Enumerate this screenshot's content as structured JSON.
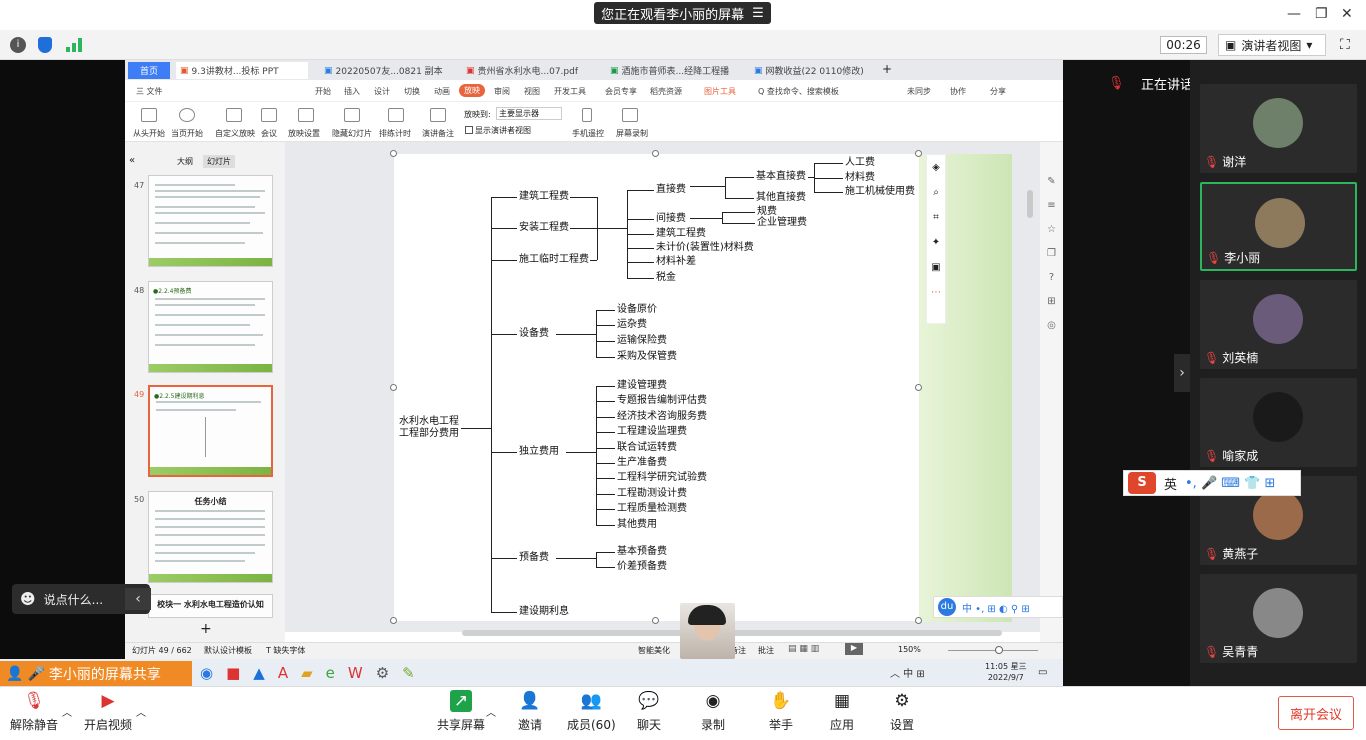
{
  "banner": {
    "text": "您正在观看李小丽的屏幕"
  },
  "toolbar2": {
    "timer": "00:26",
    "presenter_view": "演讲者视图"
  },
  "wps": {
    "tabs": [
      "首页",
      "9.3讲教材...投标 PPT",
      "20220507友...0821 副本",
      "贵州省水利水电...07.pdf",
      "酒施市普师表...经降工程播",
      "网教收益(22 0110修改)"
    ],
    "menu": [
      "三 文件",
      "开始",
      "插入",
      "设计",
      "切换",
      "动画",
      "放映",
      "审阅",
      "视图",
      "开发工具",
      "会员专享",
      "稻壳资源",
      "图片工具",
      "Q 查找命令、搜索模板",
      "未同步",
      "协作",
      "分享"
    ],
    "ribbon": [
      "从头开始",
      "当页开始",
      "自定义放映",
      "会议",
      "放映设置",
      "隐藏幻灯片",
      "排练计时",
      "演讲备注",
      "手机遥控",
      "屏幕录制"
    ],
    "ribbon_opts": {
      "monitor_label": "放映到:",
      "monitor_value": "主要显示器",
      "presenter_check": "显示演讲者视图"
    },
    "panel_tabs": [
      "大纲",
      "幻灯片"
    ],
    "slides": [
      {
        "num": "47",
        "title": ""
      },
      {
        "num": "48",
        "title": "●2.2.4预备费"
      },
      {
        "num": "49",
        "title": "●2.2.5建设期利息"
      },
      {
        "num": "50",
        "title": "任务小结"
      },
      {
        "num": "",
        "title": "校块一 水利水电工程造价认知"
      }
    ],
    "status": {
      "slide_count": "幻灯片 49 / 662",
      "theme": "默认设计模板",
      "font": "T 缺失字体",
      "smart": "智能美化",
      "notes": "备注",
      "comment": "批注",
      "zoom": "150%"
    }
  },
  "tree": {
    "root": "水利水电工程\n工程部分费用",
    "l1": [
      "建筑工程费",
      "安装工程费",
      "施工临时工程费",
      "设备费",
      "独立费用",
      "预备费",
      "建设期利息"
    ],
    "l2_group": [
      "直接费",
      "间接费",
      "建筑工程费",
      "未计价(装置性)材料费",
      "材料补差",
      "税金"
    ],
    "direct": [
      "基本直接费",
      "其他直接费"
    ],
    "basic": [
      "人工费",
      "材料费",
      "施工机械使用费"
    ],
    "indirect": [
      "规费",
      "企业管理费"
    ],
    "equipment": [
      "设备原价",
      "运杂费",
      "运输保险费",
      "采购及保管费"
    ],
    "independent": [
      "建设管理费",
      "专题报告编制评估费",
      "经济技术咨询服务费",
      "工程建设监理费",
      "联合试运转费",
      "生产准备费",
      "工程科学研究试验费",
      "工程勘测设计费",
      "工程质量检测费",
      "其他费用"
    ],
    "reserve": [
      "基本预备费",
      "价差预备费"
    ]
  },
  "chat": {
    "placeholder": "说点什么..."
  },
  "share_label": "李小丽的屏幕共享",
  "taskbar": {
    "time": "11:05 星三",
    "date": "2022/9/7"
  },
  "speaking": "正在讲话: 李小丽;",
  "ime": {
    "lang": "英"
  },
  "participants": [
    {
      "name": "谢洋",
      "color": "#6e7f6a"
    },
    {
      "name": "李小丽",
      "color": "#8d7a5d"
    },
    {
      "name": "刘英楠",
      "color": "#6b5b7b"
    },
    {
      "name": "喻家成",
      "color": "#1a1a1a"
    },
    {
      "name": "黄燕子",
      "color": "#9a6a4a"
    },
    {
      "name": "吴青青",
      "color": "#888888"
    }
  ],
  "bottom": {
    "mute": "解除静音",
    "video": "开启视频",
    "share": "共享屏幕",
    "invite": "邀请",
    "members": "成员(60)",
    "chat": "聊天",
    "record": "录制",
    "raise": "举手",
    "apps": "应用",
    "settings": "设置",
    "leave": "离开会议"
  }
}
